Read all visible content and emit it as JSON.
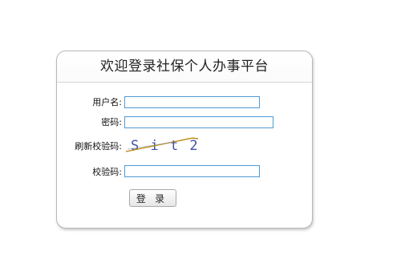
{
  "card": {
    "title": "欢迎登录社保个人办事平台"
  },
  "form": {
    "username_label": "用户名:",
    "username_value": "",
    "password_label": "密码:",
    "password_value": "",
    "refresh_captcha_label": "刷新校验码:",
    "captcha_text": "S i t 2",
    "captcha_label": "校验码:",
    "captcha_value": "",
    "login_button_label": "登 录"
  },
  "colors": {
    "input_border": "#4f9ad6",
    "captcha_text": "#3f4fa8",
    "captcha_strike": "#b8860b"
  }
}
